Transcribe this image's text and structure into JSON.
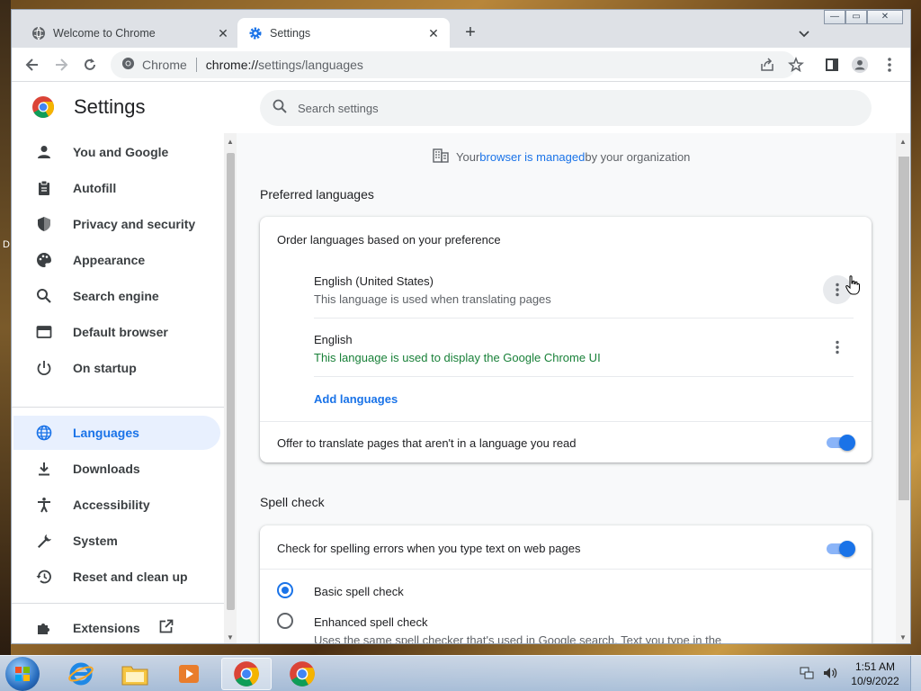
{
  "desktop": {
    "edge_text": "D"
  },
  "window_controls": {
    "minimize": "—",
    "maximize": "▭",
    "close": "✕"
  },
  "tabs": [
    {
      "title": "Welcome to Chrome",
      "close": "✕"
    },
    {
      "title": "Settings",
      "close": "✕"
    }
  ],
  "new_tab_label": "+",
  "omnibox": {
    "site_label": "Chrome",
    "url_host": "chrome://",
    "url_path": "settings/languages"
  },
  "settings": {
    "title": "Settings",
    "search_placeholder": "Search settings",
    "managed": {
      "prefix": "Your ",
      "link": "browser is managed",
      "suffix": " by your organization"
    }
  },
  "sidebar": {
    "items": [
      {
        "label": "You and Google",
        "icon": "person-icon"
      },
      {
        "label": "Autofill",
        "icon": "clipboard-icon"
      },
      {
        "label": "Privacy and security",
        "icon": "shield-icon"
      },
      {
        "label": "Appearance",
        "icon": "palette-icon"
      },
      {
        "label": "Search engine",
        "icon": "search-icon"
      },
      {
        "label": "Default browser",
        "icon": "browser-window-icon"
      },
      {
        "label": "On startup",
        "icon": "power-icon"
      },
      {
        "label": "Languages",
        "icon": "globe-icon",
        "selected": true
      },
      {
        "label": "Downloads",
        "icon": "download-icon"
      },
      {
        "label": "Accessibility",
        "icon": "accessibility-icon"
      },
      {
        "label": "System",
        "icon": "wrench-icon"
      },
      {
        "label": "Reset and clean up",
        "icon": "restore-icon"
      },
      {
        "label": "Extensions",
        "icon": "puzzle-icon"
      }
    ]
  },
  "preferred_languages": {
    "heading": "Preferred languages",
    "order_label": "Order languages based on your preference",
    "languages": [
      {
        "name": "English (United States)",
        "note": "This language is used when translating pages"
      },
      {
        "name": "English",
        "note": "This language is used to display the Google Chrome UI"
      }
    ],
    "add_label": "Add languages",
    "offer_translate_label": "Offer to translate pages that aren't in a language you read",
    "offer_translate_on": true
  },
  "spell_check": {
    "heading": "Spell check",
    "check_label": "Check for spelling errors when you type text on web pages",
    "check_on": true,
    "basic_label": "Basic spell check",
    "enhanced_label": "Enhanced spell check",
    "enhanced_desc": "Uses the same spell checker that's used in Google search. Text you type in the",
    "selected": "basic"
  },
  "taskbar": {
    "time": "1:51 AM",
    "date": "10/9/2022",
    "apps": [
      "internet-explorer-icon",
      "file-explorer-icon",
      "media-player-icon",
      "chrome-icon",
      "chrome-icon"
    ]
  },
  "colors": {
    "accent": "#1a73e8",
    "selected_bg": "#e8f0fe",
    "green_note": "#188038"
  }
}
